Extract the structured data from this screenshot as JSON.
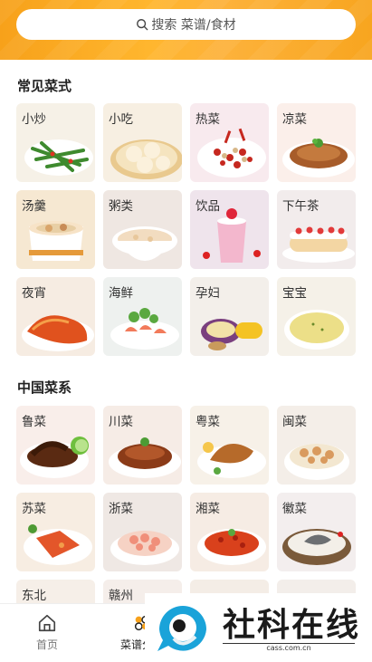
{
  "search": {
    "placeholder": "搜索 菜谱/食材"
  },
  "sections": [
    {
      "title": "常见菜式",
      "items": [
        "小炒",
        "小吃",
        "热菜",
        "凉菜",
        "汤羹",
        "粥类",
        "饮品",
        "下午茶",
        "夜宵",
        "海鲜",
        "孕妇",
        "宝宝"
      ]
    },
    {
      "title": "中国菜系",
      "items": [
        "鲁菜",
        "川菜",
        "粤菜",
        "闽菜",
        "苏菜",
        "浙菜",
        "湘菜",
        "徽菜",
        "东北",
        "赣州",
        "",
        ""
      ]
    }
  ],
  "nav": {
    "home": "首页",
    "recipes": "菜谱分类"
  },
  "watermark": {
    "brand": "社科在线",
    "domain": "cass.com.cn"
  },
  "colors": {
    "accent": "#f7a11a",
    "watermark_blue": "#1aa3d9"
  }
}
